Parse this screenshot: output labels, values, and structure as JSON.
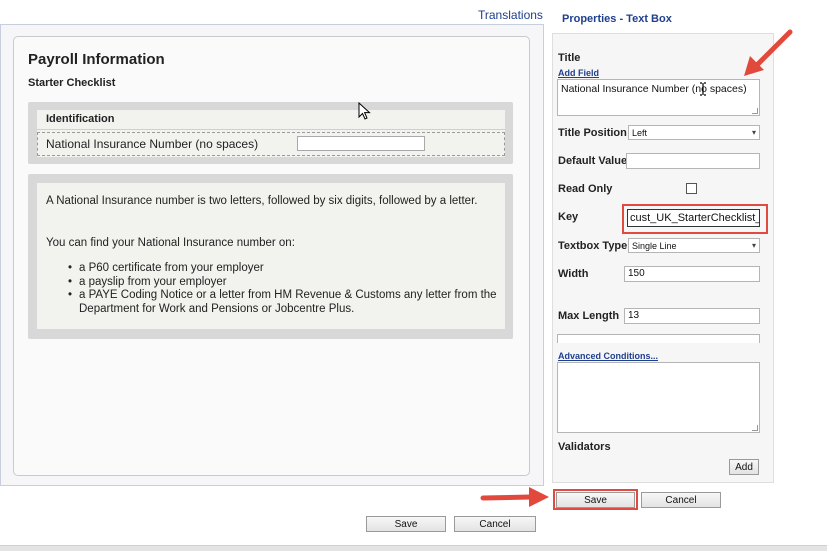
{
  "designer": {
    "translations_link": "Translations",
    "form_title": "Payroll Information",
    "form_subtitle": "Starter Checklist",
    "section": {
      "heading": "Identification",
      "field_label": "National Insurance Number (no spaces)",
      "field_value": ""
    },
    "info": {
      "paragraph1": "A National Insurance number is two letters, followed by six digits, followed by a letter.",
      "paragraph2": "You can find your National Insurance number on:",
      "items": [
        "a P60 certificate from your employer",
        "a payslip from your employer",
        "a PAYE Coding Notice or a letter from HM Revenue & Customs any letter from the Department for Work and Pensions or Jobcentre Plus."
      ],
      "bullet": "•"
    },
    "buttons": {
      "save": "Save",
      "cancel": "Cancel"
    }
  },
  "properties": {
    "panel_title": "Properties - Text Box",
    "title_label": "Title",
    "add_field_link": "Add Field",
    "title_value": "National Insurance Number (no spaces)",
    "title_position_label": "Title Position",
    "title_position_value": "Left",
    "default_value_label": "Default Value",
    "default_value": "",
    "read_only_label": "Read Only",
    "read_only_checked": false,
    "key_label": "Key",
    "key_value": "cust_UK_StarterChecklist_",
    "textbox_type_label": "Textbox Type",
    "textbox_type_value": "Single Line",
    "width_label": "Width",
    "width_value": "150",
    "max_length_label": "Max Length",
    "max_length_value": "13",
    "advanced_conditions_link": "Advanced Conditions...",
    "advanced_conditions_value": "",
    "validators_label": "Validators",
    "add_button": "Add",
    "buttons": {
      "save": "Save",
      "cancel": "Cancel"
    }
  },
  "colors": {
    "accent_link": "#1f3f8f",
    "highlight_red": "#e14b3f",
    "arrow_red": "#e0493c"
  },
  "icons": {
    "chevron": "▾",
    "arrow": "red-arrow-icon",
    "text_cursor": "i-beam-cursor-icon",
    "pointer": "mouse-pointer-icon"
  }
}
